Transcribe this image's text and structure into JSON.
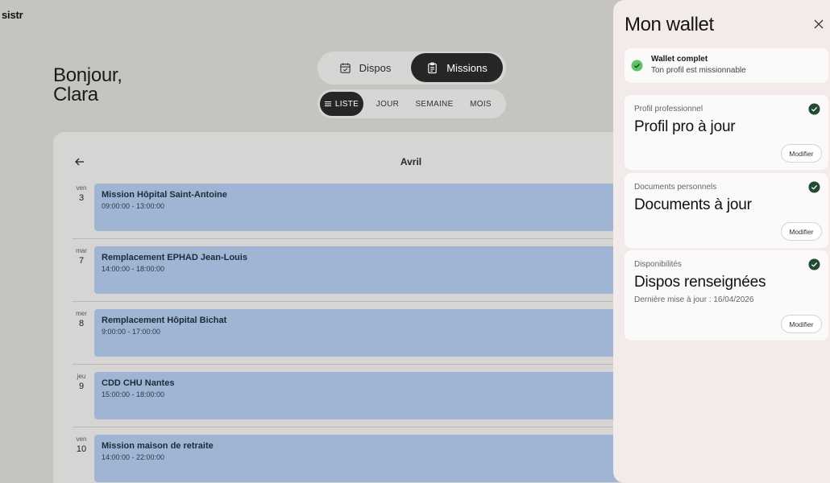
{
  "app": {
    "logo": "sistr"
  },
  "greeting": {
    "line1": "Bonjour,",
    "line2": "Clara"
  },
  "mode_switch": {
    "dispos": "Dispos",
    "missions": "Missions",
    "active": "missions"
  },
  "view_switch": {
    "liste": "LISTE",
    "jour": "JOUR",
    "semaine": "SEMAINE",
    "mois": "MOIS",
    "active": "liste"
  },
  "calendar": {
    "month": "Avril",
    "missions": [
      {
        "day_name": "ven",
        "day_num": "3",
        "title": "Mission Hôpital Saint-Antoine",
        "time": "09:00:00 - 13:00:00"
      },
      {
        "day_name": "mar",
        "day_num": "7",
        "title": "Remplacement EPHAD Jean-Louis",
        "time": "14:00:00 - 18:00:00"
      },
      {
        "day_name": "mer",
        "day_num": "8",
        "title": "Remplacement Hôpital Bichat",
        "time": "9:00:00 - 17:00:00"
      },
      {
        "day_name": "jeu",
        "day_num": "9",
        "title": "CDD CHU Nantes",
        "time": "15:00:00 - 18:00:00"
      },
      {
        "day_name": "ven",
        "day_num": "10",
        "title": "Mission maison de retraite",
        "time": "14:00:00 - 22:00:00"
      }
    ]
  },
  "wallet": {
    "title": "Mon wallet",
    "status": {
      "title": "Wallet complet",
      "subtitle": "Ton profil est missionnable"
    },
    "sections": [
      {
        "label": "Profil professionnel",
        "title": "Profil pro à jour",
        "button": "Modifier"
      },
      {
        "label": "Documents personnels",
        "title": "Documents à jour",
        "button": "Modifier"
      },
      {
        "label": "Disponibilités",
        "title": "Dispos renseignées",
        "subtitle": "Dernière mise à jour : 16/04/2026",
        "button": "Modifier"
      }
    ]
  },
  "colors": {
    "background": "#c6c4c1",
    "mission_block": "#9fb5d3",
    "dark_toggle": "#262626",
    "wallet_bg": "#f3eaea",
    "check_green": "#1f4a33",
    "status_green": "#5ec46a"
  },
  "icons": {
    "dispos": "calendar-check-icon",
    "missions": "clipboard-icon",
    "liste": "list-icon",
    "back": "arrow-left-icon",
    "close": "close-icon",
    "status": "check-circle-icon",
    "section_check": "check-circle-icon"
  }
}
